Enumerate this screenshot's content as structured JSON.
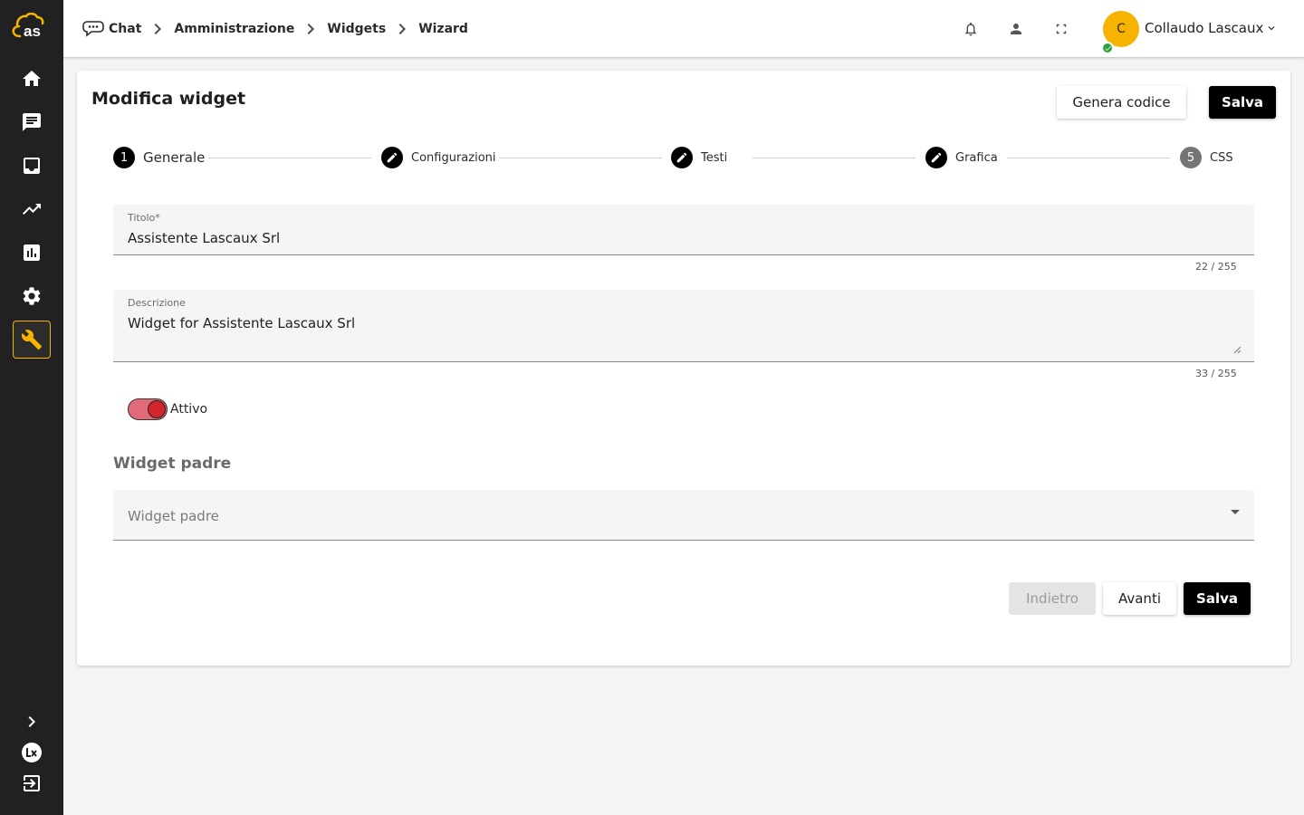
{
  "app": {
    "logo_text": "as",
    "nav": [
      {
        "name": "home",
        "icon": "home-icon"
      },
      {
        "name": "chat",
        "icon": "chat-icon"
      },
      {
        "name": "inbox",
        "icon": "inbox-icon"
      },
      {
        "name": "trending",
        "icon": "trending-up-icon"
      },
      {
        "name": "reports",
        "icon": "bar-chart-icon"
      },
      {
        "name": "settings",
        "icon": "gear-icon"
      },
      {
        "name": "tools",
        "icon": "wrench-icon",
        "active": true
      }
    ],
    "bottom": [
      {
        "name": "expand",
        "icon": "chevron-right-icon"
      },
      {
        "name": "brand",
        "icon": "lx-logo-icon"
      },
      {
        "name": "logout",
        "icon": "logout-icon"
      }
    ]
  },
  "breadcrumb": [
    "Chat",
    "Amministrazione",
    "Widgets",
    "Wizard"
  ],
  "header": {
    "avatar_initial": "C",
    "user_name": "Collaudo Lascaux",
    "status": "online"
  },
  "page": {
    "title": "Modifica widget",
    "generate_button": "Genera codice",
    "save_button": "Salva"
  },
  "stepper": [
    {
      "marker": "1",
      "label": "Generale",
      "state": "current"
    },
    {
      "marker": "edit",
      "label": "Configurazioni",
      "state": "edited"
    },
    {
      "marker": "edit",
      "label": "Testi",
      "state": "edited"
    },
    {
      "marker": "edit",
      "label": "Grafica",
      "state": "edited"
    },
    {
      "marker": "5",
      "label": "CSS",
      "state": "pending"
    }
  ],
  "form": {
    "title": {
      "label": "Titolo*",
      "value": "Assistente Lascaux Srl",
      "counter": "22 / 255"
    },
    "description": {
      "label": "Descrizione",
      "value": "Widget for Assistente Lascaux Srl",
      "counter": "33 / 255"
    },
    "active": {
      "label": "Attivo",
      "checked": true
    },
    "parent_section": "Widget padre",
    "parent_select": {
      "placeholder": "Widget padre",
      "value": ""
    }
  },
  "footer": {
    "back_button": "Indietro",
    "next_button": "Avanti",
    "save_button": "Salva"
  },
  "colors": {
    "sidebar": "#212121",
    "accent": "#f6b400",
    "toggle_track": "#e06a78",
    "toggle_knob": "#d4252f",
    "primary_button": "#000000",
    "status_online": "#2ea043"
  }
}
